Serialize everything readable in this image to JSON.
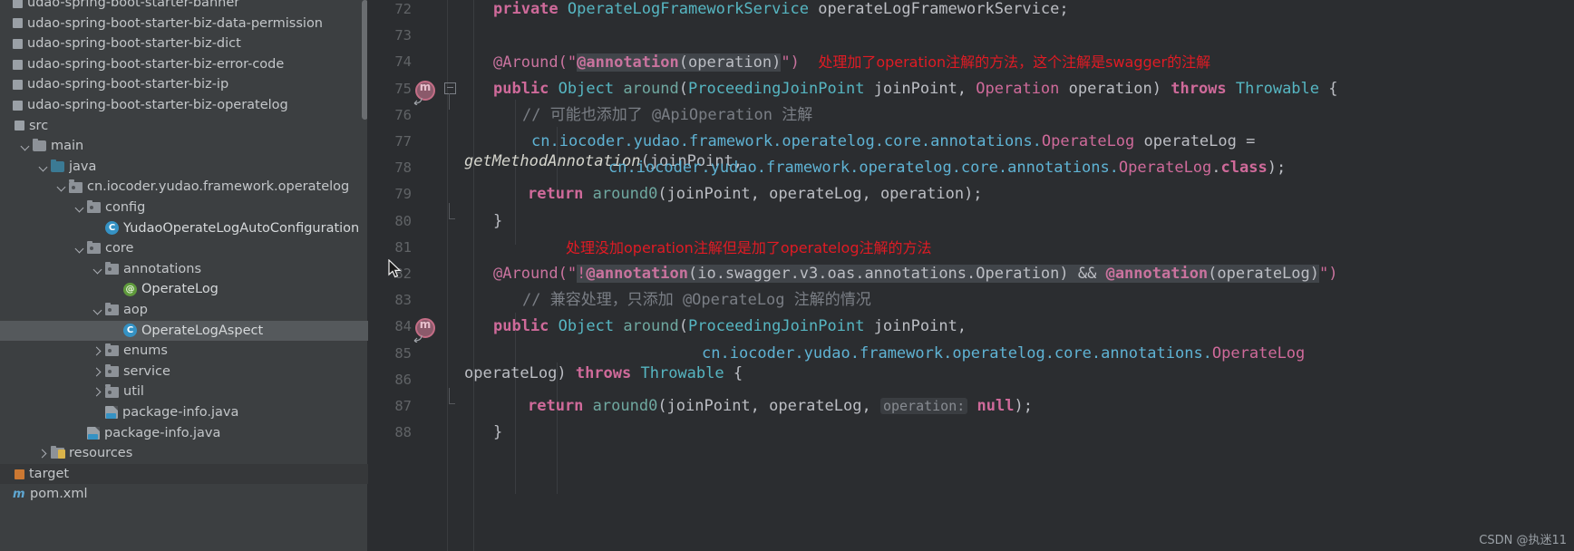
{
  "project_tree": {
    "modules": [
      {
        "label": "udao-spring-boot-starter-banner",
        "icon": "module-icon",
        "indent": 0,
        "type": "module",
        "arrow": "none",
        "clipped": true
      },
      {
        "label": "udao-spring-boot-starter-biz-data-permission",
        "icon": "module-icon",
        "indent": 0,
        "type": "module",
        "arrow": "none",
        "clipped": true
      },
      {
        "label": "udao-spring-boot-starter-biz-dict",
        "icon": "module-icon",
        "indent": 0,
        "type": "module",
        "arrow": "none",
        "clipped": true
      },
      {
        "label": "udao-spring-boot-starter-biz-error-code",
        "icon": "module-icon",
        "indent": 0,
        "type": "module",
        "arrow": "none",
        "clipped": true
      },
      {
        "label": "udao-spring-boot-starter-biz-ip",
        "icon": "module-icon",
        "indent": 0,
        "type": "module",
        "arrow": "none",
        "clipped": true
      },
      {
        "label": "udao-spring-boot-starter-biz-operatelog",
        "icon": "module-icon",
        "indent": 0,
        "type": "module",
        "arrow": "none",
        "clipped": true
      },
      {
        "label": "src",
        "icon": "module-icon",
        "indent": 0,
        "type": "source-root",
        "arrow": "none"
      },
      {
        "label": "main",
        "icon": "folder-icon",
        "indent": 1,
        "type": "folder",
        "arrow": "down"
      },
      {
        "label": "java",
        "icon": "folder-blue-icon",
        "indent": 2,
        "type": "source-folder",
        "arrow": "down"
      },
      {
        "label": "cn.iocoder.yudao.framework.operatelog",
        "icon": "package-icon",
        "indent": 3,
        "type": "package",
        "arrow": "down"
      },
      {
        "label": "config",
        "icon": "package-icon",
        "indent": 4,
        "type": "package",
        "arrow": "down"
      },
      {
        "label": "YudaoOperateLogAutoConfiguration",
        "icon": "java-class-icon",
        "indent": 5,
        "type": "class",
        "arrow": "none"
      },
      {
        "label": "core",
        "icon": "package-icon",
        "indent": 4,
        "type": "package",
        "arrow": "down"
      },
      {
        "label": "annotations",
        "icon": "package-icon",
        "indent": 5,
        "type": "package",
        "arrow": "down"
      },
      {
        "label": "OperateLog",
        "icon": "java-annotation-icon",
        "indent": 6,
        "type": "annotation",
        "arrow": "none"
      },
      {
        "label": "aop",
        "icon": "package-icon",
        "indent": 5,
        "type": "package",
        "arrow": "down"
      },
      {
        "label": "OperateLogAspect",
        "icon": "java-class-icon",
        "indent": 6,
        "type": "class",
        "arrow": "none",
        "selected": true
      },
      {
        "label": "enums",
        "icon": "package-icon",
        "indent": 5,
        "type": "package",
        "arrow": "right"
      },
      {
        "label": "service",
        "icon": "package-icon",
        "indent": 5,
        "type": "package",
        "arrow": "right"
      },
      {
        "label": "util",
        "icon": "package-icon",
        "indent": 5,
        "type": "package",
        "arrow": "right"
      },
      {
        "label": "package-info.java",
        "icon": "java-file-icon",
        "indent": 5,
        "type": "file",
        "arrow": "none"
      },
      {
        "label": "package-info.java",
        "icon": "java-file-icon",
        "indent": 4,
        "type": "file",
        "arrow": "none"
      },
      {
        "label": "resources",
        "icon": "resources-folder-icon",
        "indent": 2,
        "type": "folder",
        "arrow": "right"
      },
      {
        "label": "target",
        "icon": "module-orange-icon",
        "indent": 0,
        "type": "excluded-folder",
        "arrow": "none",
        "highlight": true
      },
      {
        "label": "pom.xml",
        "icon": "maven-xml-icon",
        "indent": 0,
        "type": "file",
        "arrow": "none",
        "clipped": true
      }
    ]
  },
  "editor": {
    "lines": [
      {
        "num": "72",
        "indent_guides": 1
      },
      {
        "num": "73",
        "indent_guides": 1
      },
      {
        "num": "74",
        "indent_guides": 1
      },
      {
        "num": "75",
        "indent_guides": 1,
        "gutter": "run-method-icon"
      },
      {
        "num": "76",
        "indent_guides": 2
      },
      {
        "num": "77",
        "indent_guides": 2
      },
      {
        "num": "78",
        "indent_guides": 3
      },
      {
        "num": "79",
        "indent_guides": 2
      },
      {
        "num": "80",
        "indent_guides": 1,
        "gutter": "fold-end-icon"
      },
      {
        "num": "81",
        "indent_guides": 1
      },
      {
        "num": "82",
        "indent_guides": 1
      },
      {
        "num": "83",
        "indent_guides": 2
      },
      {
        "num": "84",
        "indent_guides": 1,
        "gutter": "run-method-icon"
      },
      {
        "num": "85",
        "indent_guides": 2
      },
      {
        "num": "86",
        "indent_guides": 2
      },
      {
        "num": "87",
        "indent_guides": 1,
        "gutter": "fold-end-icon"
      },
      {
        "num": "88",
        "indent_guides": 1
      }
    ],
    "code": {
      "l72_private": "private",
      "l72_type": "OperateLogFrameworkService",
      "l72_var": " operateLogFrameworkService",
      "l72_semi": ";",
      "l74_anno": "@Around(",
      "l74_q1": "\"",
      "l74_hl_a": "@annotation",
      "l74_hl_b": "(operation)",
      "l74_q2": "\"",
      "l74_close": ")",
      "l74_comment": "处理加了operation注解的方法，这个注解是swagger的注解",
      "l75_public": "public",
      "l75_object": " Object ",
      "l75_around": "around",
      "l75_p1": "(",
      "l75_pjp": "ProceedingJoinPoint",
      "l75_jp": " joinPoint, ",
      "l75_op": "Operation",
      "l75_opv": " operation) ",
      "l75_throws": "throws",
      "l75_thr": " Throwable",
      "l75_brace": " {",
      "l76_comment": "// 可能也添加了 @ApiOperation 注解",
      "l77_fqn": "cn.iocoder.yudao.framework.operatelog.core.annotations.",
      "l77_type": "OperateLog",
      "l77_var": " operateLog =",
      "l77b_meth": "getMethodAnnotation",
      "l77b_args": "(joinPoint,",
      "l78_fqn": "cn.iocoder.yudao.framework.operatelog.core.annotations.",
      "l78_type": "OperateLog",
      "l78_dot": ".",
      "l78_class": "class",
      "l78_tail": ");",
      "l79_return": "return",
      "l79_call": " around0",
      "l79_args": "(joinPoint, operateLog, operation);",
      "l80_brace": "}",
      "l81_comment": "处理没加operation注解但是加了operatelog注解的方法",
      "l82_anno": "@Around(",
      "l82_q1": "\"",
      "l82_bang": "!",
      "l82_hl_a": "@annotation",
      "l82_hl_b": "(io.swagger.v3.oas.annotations.Operation)",
      "l82_amp": " && ",
      "l82_hl_c": "@annotation",
      "l82_hl_d": "(operateLog)",
      "l82_q2": "\"",
      "l82_close": ")",
      "l83_comment": "// 兼容处理，只添加 @OperateLog 注解的情况",
      "l84_public": "public",
      "l84_object": " Object ",
      "l84_around": "around",
      "l84_p1": "(",
      "l84_pjp": "ProceedingJoinPoint",
      "l84_jp": " joinPoint,",
      "l85_fqn": "cn.iocoder.yudao.framework.operatelog.core.annotations.",
      "l85_type": "OperateLog",
      "l85b_var": "operateLog) ",
      "l85b_throws": "throws",
      "l85b_thr": " Throwable",
      "l85b_brace": " {",
      "l86_return": "return",
      "l86_call": " around0",
      "l86_args": "(joinPoint, operateLog, ",
      "l86_inlay": "operation:",
      "l86_null": "null",
      "l86_tail": ");",
      "l87_brace": "}"
    }
  },
  "watermark": "CSDN @执迷11",
  "colors": {
    "tree_background": "#3c3f41",
    "editor_background": "#2b2d30",
    "selection": "#55595c",
    "keyword": "#cf6a9a",
    "type": "#56b6c2",
    "red_comment": "#e01b24",
    "grey_comment": "#7a7e85",
    "fqn_blue": "#5fb3d4",
    "accent_class_icon": "#3592c4",
    "accent_annotation_icon": "#5f9a3c"
  }
}
